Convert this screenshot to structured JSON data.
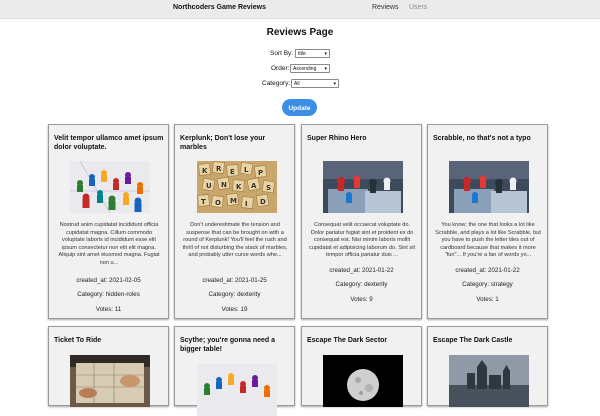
{
  "nav": {
    "brand": "Northcoders Game Reviews",
    "links": [
      "Reviews",
      "Users"
    ]
  },
  "page": {
    "title": "Reviews Page",
    "update_label": "Update"
  },
  "controls": {
    "sort_by": {
      "label": "Sort By:",
      "value": "title"
    },
    "order": {
      "label": "Order:",
      "value": "Ascending"
    },
    "category": {
      "label": "Category:",
      "value": "All"
    }
  },
  "reviews": [
    {
      "title": "Velit tempor ullamco amet ipsum dolor voluptate.",
      "body": "Nostrud anim cupidatat incididunt officia cupidatat magna. Cillum commodo voluptate laboris id incididunt esse elit ipsum consectetur non elit elit magna. Aliquip sint amet eiusmod magna. Fugiat non u...",
      "created_at": "created_at: 2021-02-05",
      "category": "Category: hidden-roles",
      "votes": "Votes: 11",
      "image": "meeples"
    },
    {
      "title": "Kerplunk; Don't lose your marbles",
      "body": "Don't underestimate the tension and suspense that can be brought on with a round of Kerplunk! You'll feel the rush and thrill of not disturbing the stack of marbles, and probably utter curse words whe...",
      "created_at": "created_at: 2021-01-25",
      "category": "Category: dexterity",
      "votes": "Votes: 19",
      "image": "tiles"
    },
    {
      "title": "Super Rhino Hero",
      "body": "Consequat velit occaecat voluptate do. Dolor pariatur fugiat sint et proident ex do consequat est. Nisi minim laboris mollit cupidatat et adipisicing laborum do. Sint sit tempor officia pariatur duis ...",
      "created_at": "created_at: 2021-01-22",
      "category": "Category: dexterity",
      "votes": "Votes: 9",
      "image": "pieces"
    },
    {
      "title": "Scrabble, no that's not a typo",
      "body": "You know; the one that looks a lot like Scrabble, and plays a lot like Scrabble, but you have to push the letter tiles out of cardboard because that makes it more \"fun\"... If you're a fan of words yo...",
      "created_at": "created_at: 2021-01-22",
      "category": "Category: strategy",
      "votes": "Votes: 1",
      "image": "pieces"
    },
    {
      "title": "Ticket To Ride",
      "image": "hands"
    },
    {
      "title": "Scythe; you're gonna need a bigger table!",
      "image": "meeples"
    },
    {
      "title": "Escape The Dark Sector",
      "image": "moon"
    },
    {
      "title": "Escape The Dark Castle",
      "image": "castle"
    }
  ]
}
